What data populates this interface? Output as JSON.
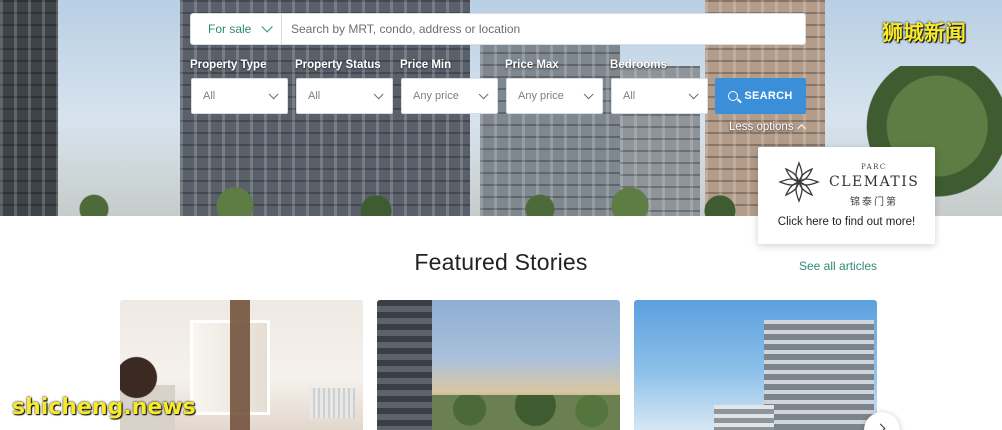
{
  "search": {
    "listing_type": "For sale",
    "placeholder": "Search by MRT, condo, address or location",
    "button_label": "SEARCH",
    "less_options": "Less options"
  },
  "filters": [
    {
      "label": "Property Type",
      "value": "All"
    },
    {
      "label": "Property Status",
      "value": "All"
    },
    {
      "label": "Price Min",
      "value": "Any price"
    },
    {
      "label": "Price Max",
      "value": "Any price"
    },
    {
      "label": "Bedrooms",
      "value": "All"
    }
  ],
  "ad": {
    "prefix": "PARC",
    "name": "CLEMATIS",
    "chinese_name": "锦泰门第",
    "cta": "Click here to find out more!"
  },
  "featured": {
    "title": "Featured Stories",
    "see_all": "See all articles"
  },
  "watermarks": {
    "cn": "狮城新闻",
    "en": "shicheng.news"
  },
  "colors": {
    "accent_green": "#2e8a75",
    "search_blue": "#3b8ed8",
    "watermark_yellow": "#f7ea2a"
  }
}
